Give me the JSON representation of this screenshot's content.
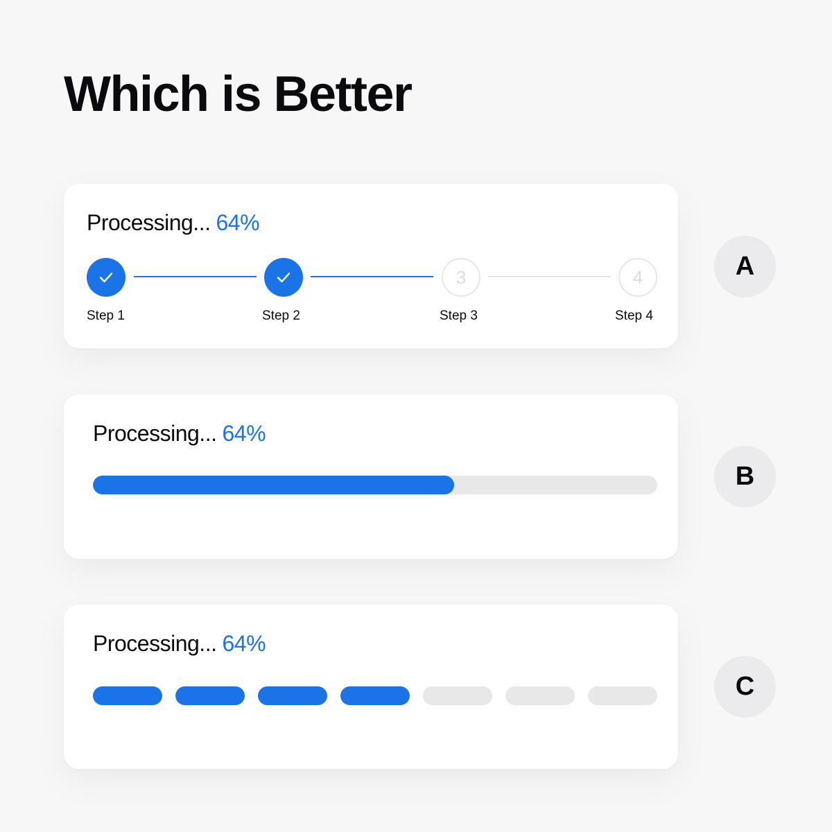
{
  "title": "Which is Better",
  "colors": {
    "accent": "#1a74e8",
    "inactive": "#e8e8e8",
    "background": "#f7f7f7",
    "card": "#ffffff"
  },
  "options": [
    {
      "label": "A",
      "heading": "Processing...",
      "percent": "64%",
      "style": "stepper",
      "steps": [
        {
          "label": "Step 1",
          "number": "1",
          "status": "complete",
          "icon": "check-icon"
        },
        {
          "label": "Step 2",
          "number": "2",
          "status": "complete",
          "icon": "check-icon"
        },
        {
          "label": "Step 3",
          "number": "3",
          "status": "pending"
        },
        {
          "label": "Step 4",
          "number": "4",
          "status": "pending"
        }
      ]
    },
    {
      "label": "B",
      "heading": "Processing...",
      "percent": "64%",
      "style": "progress-bar",
      "progress": 0.64
    },
    {
      "label": "C",
      "heading": "Processing...",
      "percent": "64%",
      "style": "segmented-bar",
      "segments_total": 7,
      "segments_filled": 4
    }
  ]
}
